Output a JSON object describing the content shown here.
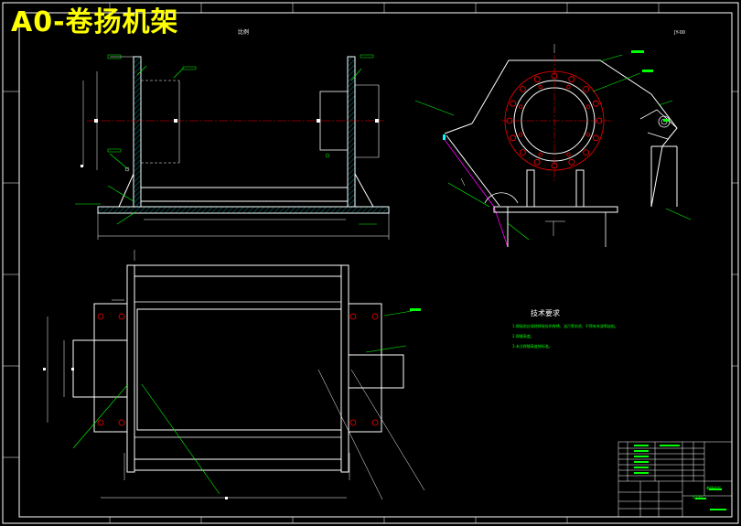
{
  "title": "A0-卷扬机架",
  "tech_requirements": {
    "heading": "技术要求",
    "notes": [
      "1.焊接前应清除焊接处的铁锈、油污等杂质，不得有夹渣等缺陷。",
      "2.焊缝高度。",
      "3.未注焊缝高度按标准。"
    ]
  },
  "title_block": {
    "scale_label": "比例",
    "drawing_no": "JY-00",
    "part_name": "卷扬机架",
    "material": "Q235"
  },
  "colors": {
    "background": "#000000",
    "outline": "#ffffff",
    "dimension": "#00ff00",
    "centerline": "#ff0000",
    "hidden": "#ff00ff",
    "hatch": "#00ffff",
    "title": "#ffff00"
  }
}
